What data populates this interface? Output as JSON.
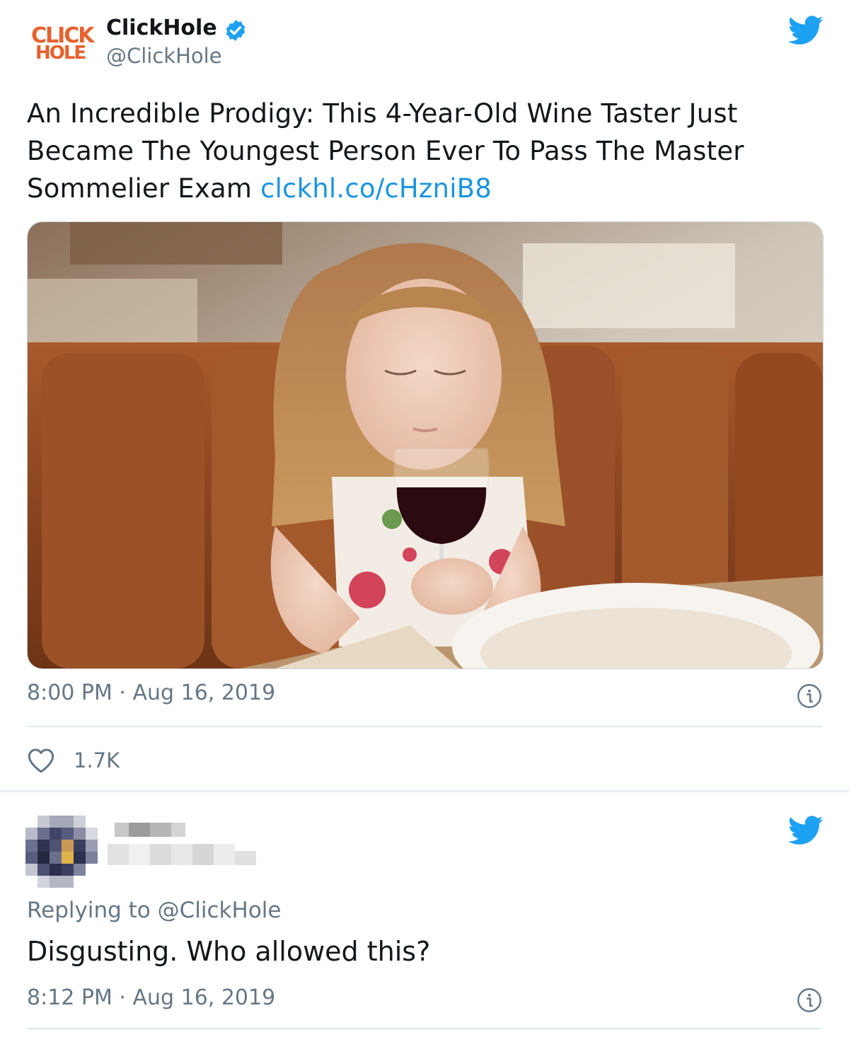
{
  "tweet": {
    "author_name": "ClickHole",
    "author_handle": "@ClickHole",
    "logo_line1": "CLICK",
    "logo_line2": "HOLE",
    "text": "An Incredible Prodigy: This 4-Year-Old Wine Taster Just Became The Youngest Person Ever To Pass The Master Sommelier Exam",
    "link": "clckhl.co/cHzniB8",
    "timestamp": "8:00 PM · Aug 16, 2019",
    "likes": "1.7K",
    "image_icon": "photo-of-girl-with-wine-glass"
  },
  "reply": {
    "replying_label": "Replying to",
    "replying_handle": "@ClickHole",
    "text": "Disgusting. Who allowed this?",
    "timestamp": "8:12 PM · Aug 16, 2019"
  },
  "colors": {
    "twitter_blue": "#1da1f2",
    "link_blue": "#1b95e0",
    "secondary_text": "#657786",
    "clickhole_orange": "#e8612c"
  }
}
